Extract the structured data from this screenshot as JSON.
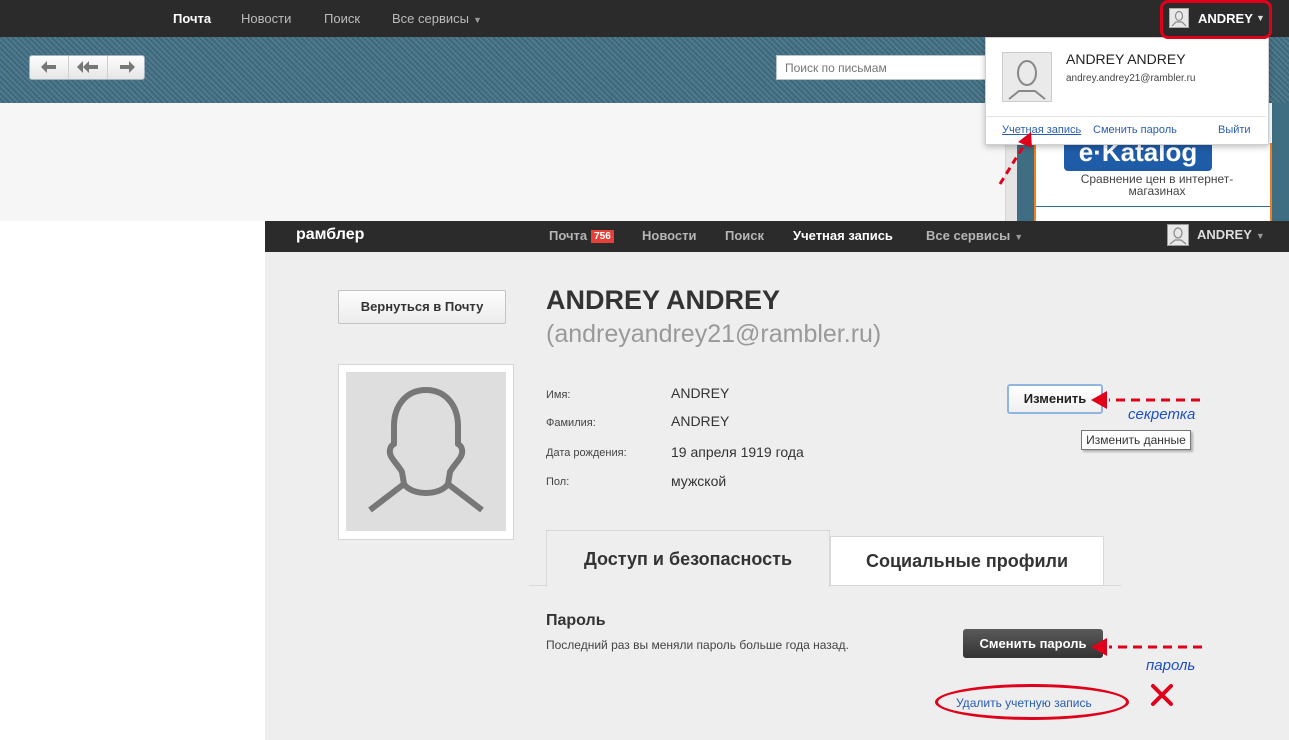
{
  "topbar": {
    "nav": [
      "Почта",
      "Новости",
      "Поиск",
      "Все сервисы"
    ],
    "user": "ANDREY"
  },
  "mail_search": {
    "placeholder": "Поиск по письмам"
  },
  "dropdown": {
    "name": "ANDREY ANDREY",
    "email": "andrey.andrey21@rambler.ru",
    "links": {
      "account": "Учетная запись",
      "change_password": "Сменить пароль",
      "logout": "Выйти"
    }
  },
  "ad": {
    "logo": "e·Katalog",
    "text": "Сравнение цен в интернет-магазинах"
  },
  "account_bar": {
    "logo": "рамблер",
    "nav": [
      "Почта",
      "Новости",
      "Поиск",
      "Учетная запись",
      "Все сервисы"
    ],
    "mail_count": "756",
    "user": "ANDREY"
  },
  "profile": {
    "back_label": "Вернуться в Почту",
    "full_name": "ANDREY ANDREY",
    "email_display": "(andreyandrey21@rambler.ru)",
    "fields": [
      {
        "label": "Имя:",
        "value": "ANDREY"
      },
      {
        "label": "Фамилия:",
        "value": "ANDREY"
      },
      {
        "label": "Дата рождения:",
        "value": "19 апреля 1919 года"
      },
      {
        "label": "Пол:",
        "value": "мужской"
      }
    ],
    "edit_label": "Изменить",
    "tooltip": "Изменить данные"
  },
  "tabs": [
    "Доступ и безопасность",
    "Социальные профили"
  ],
  "password": {
    "title": "Пароль",
    "description": "Последний раз вы меняли пароль больше года назад.",
    "change_label": "Сменить пароль"
  },
  "delete_label": "Удалить учетную запись",
  "annotations": {
    "secret_note": "секретка",
    "password_note": "пароль"
  },
  "colors": {
    "highlight_red": "#e0001a",
    "note_blue": "#1f4fc4",
    "link_blue": "#2a5db0",
    "badge_red": "#e5413a"
  }
}
